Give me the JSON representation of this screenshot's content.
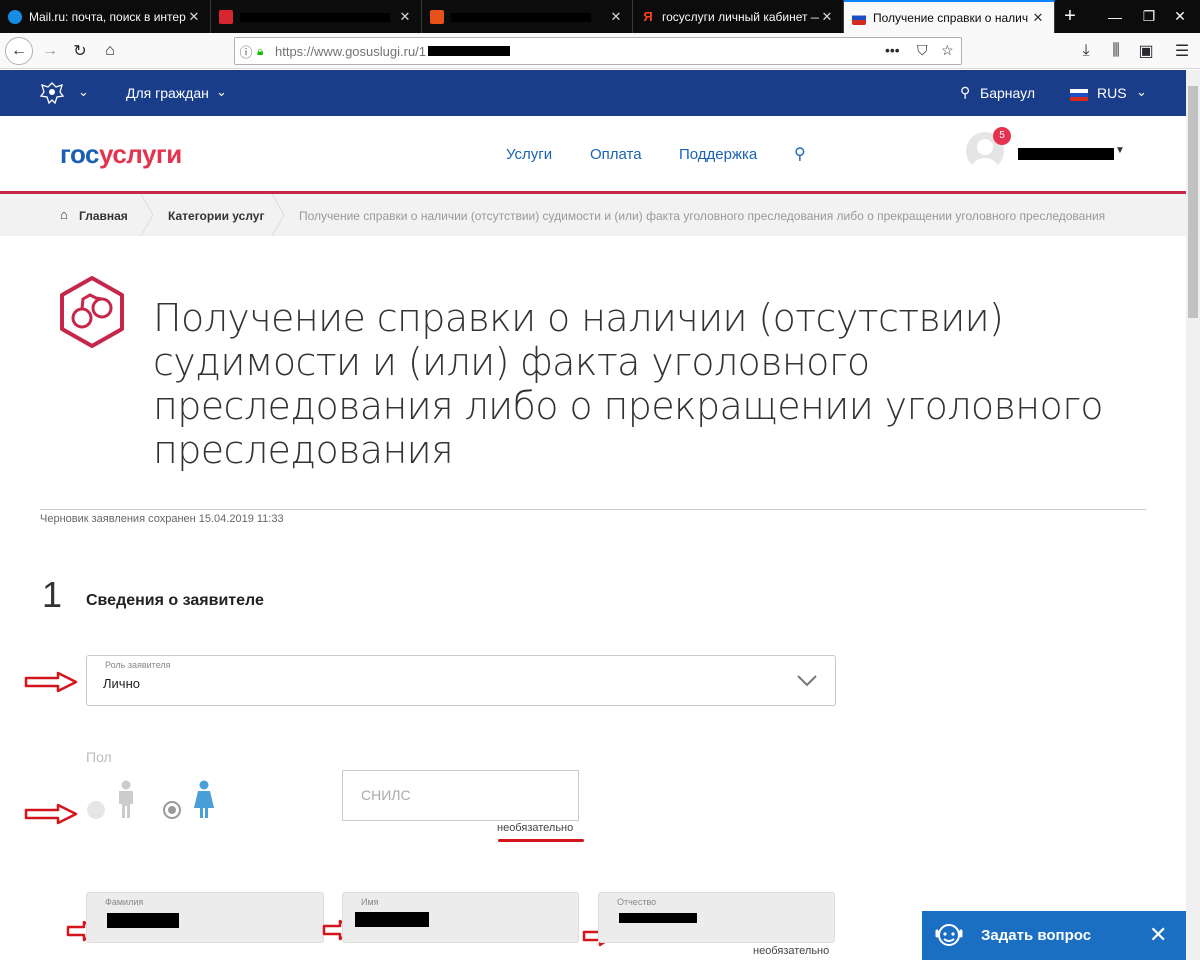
{
  "browser": {
    "tabs": [
      {
        "title": "Mail.ru: почта, поиск в интерне",
        "favicon_color": "#168de2"
      },
      {
        "title": "",
        "favicon_color": "#d7262f",
        "redacted": true
      },
      {
        "title": "",
        "favicon_color": "#e8521a",
        "redacted": true
      },
      {
        "title": "госуслуги личный кабинет —",
        "favicon_color": "#fc3f1d"
      },
      {
        "title": "Получение справки о налич",
        "favicon_color": "#1a3d8a",
        "active": true
      }
    ],
    "new_tab": "+",
    "url": "https://www.gosuslugi.ru/1"
  },
  "topbar": {
    "citizens": "Для граждан",
    "city": "Барнаул",
    "lang": "RUS"
  },
  "header": {
    "logo_gos": "гос",
    "logo_uslugi": "услуги",
    "nav": [
      "Услуги",
      "Оплата",
      "Поддержка"
    ],
    "notifications": "5"
  },
  "breadcrumbs": [
    "Главная",
    "Категории услуг",
    "Получение справки о наличии (отсутствии) судимости и (или) факта уголовного преследования либо о прекращении уголовного преследования"
  ],
  "page": {
    "title": "Получение справки о наличии (отсутствии) судимости и (или) факта уголовного преследования либо о прекращении уголовного преследования",
    "draft_saved": "Черновик заявления сохранен 15.04.2019 11:33"
  },
  "form": {
    "step_number": "1",
    "step_title": "Сведения о заявителе",
    "role": {
      "label": "Роль заявителя",
      "value": "Лично"
    },
    "gender": {
      "label": "Пол",
      "selected": "female"
    },
    "snils": {
      "placeholder": "СНИЛС",
      "note": "необязательно"
    },
    "last_name": {
      "label": "Фамилия"
    },
    "first_name": {
      "label": "Имя"
    },
    "patronymic": {
      "label": "Отчество",
      "note": "необязательно"
    }
  },
  "chat": {
    "label": "Задать вопрос"
  },
  "colors": {
    "topbar": "#1a3d8a",
    "brand_blue": "#1a5fb4",
    "brand_red": "#e4334f",
    "link": "#1a64b4",
    "annotation_red": "#d4151c",
    "chat": "#1a6fc2"
  }
}
